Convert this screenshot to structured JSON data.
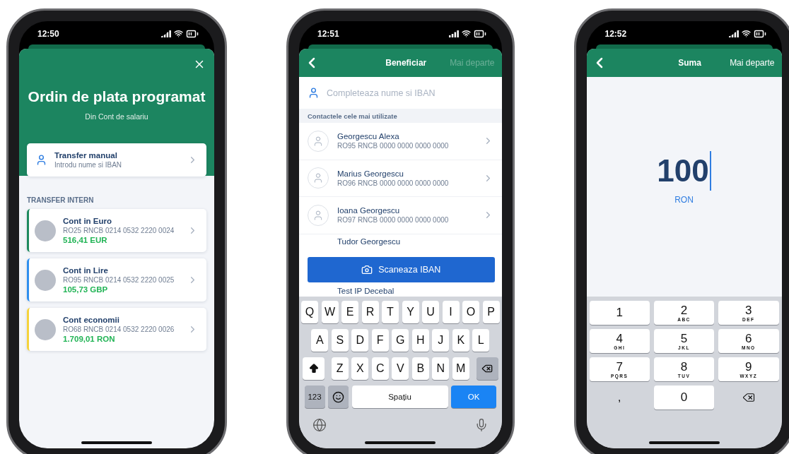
{
  "phones": [
    {
      "kind": "accounts",
      "status_time": "12:50",
      "title": "Ordin de plata programat",
      "subtitle": "Din Cont de salariu",
      "manual_transfer": {
        "title": "Transfer manual",
        "subtitle": "Introdu nume si IBAN"
      },
      "section_label": "TRANSFER INTERN",
      "accounts": [
        {
          "name": "Cont in Euro",
          "iban": "RO25 RNCB 0214 0532 2220 0024",
          "balance": "516,41 EUR",
          "color": "#1e8a5e"
        },
        {
          "name": "Cont in Lire",
          "iban": "RO95 RNCB 0214 0532 2220 0025",
          "balance": "105,73 GBP",
          "color": "#2f8fee"
        },
        {
          "name": "Cont economii",
          "iban": "RO68 RNCB 0214 0532 2220 0026",
          "balance": "1.709,01 RON",
          "color": "#f5d33c"
        }
      ]
    },
    {
      "kind": "beneficiary",
      "status_time": "12:51",
      "header": {
        "title": "Beneficiar",
        "action": "Mai departe",
        "action_disabled": true
      },
      "search": {
        "placeholder": "Completeaza nume si IBAN"
      },
      "section_label": "Contactele cele mai utilizate",
      "contacts": [
        {
          "name": "Georgescu Alexa",
          "iban": "RO95 RNCB 0000 0000 0000 0000"
        },
        {
          "name": "Marius Georgescu",
          "iban": "RO96 RNCB 0000 0000 0000 0000"
        },
        {
          "name": "Ioana Georgescu",
          "iban": "RO97 RNCB 0000 0000 0000 0000"
        },
        {
          "name": "Tudor Georgescu"
        },
        {
          "name": "Test IP Decebal"
        }
      ],
      "scan_button": "Scaneaza IBAN",
      "keyboard": {
        "rows": [
          [
            "Q",
            "W",
            "E",
            "R",
            "T",
            "Y",
            "U",
            "I",
            "O",
            "P"
          ],
          [
            "A",
            "S",
            "D",
            "F",
            "G",
            "H",
            "J",
            "K",
            "L"
          ],
          [
            "Z",
            "X",
            "C",
            "V",
            "B",
            "N",
            "M"
          ]
        ],
        "numbers_key": "123",
        "space_key": "Spațiu",
        "ok_key": "OK"
      }
    },
    {
      "kind": "amount",
      "status_time": "12:52",
      "header": {
        "title": "Suma",
        "action": "Mai departe",
        "action_disabled": false
      },
      "amount": "100",
      "currency": "RON",
      "keypad": [
        {
          "digit": "1"
        },
        {
          "digit": "2",
          "letters": "ABC"
        },
        {
          "digit": "3",
          "letters": "DEF"
        },
        {
          "digit": "4",
          "letters": "GHI"
        },
        {
          "digit": "5",
          "letters": "JKL"
        },
        {
          "digit": "6",
          "letters": "MNO"
        },
        {
          "digit": "7",
          "letters": "PQRS"
        },
        {
          "digit": "8",
          "letters": "TUV"
        },
        {
          "digit": "9",
          "letters": "WXYZ"
        }
      ],
      "comma_key": ",",
      "zero_key": "0"
    }
  ]
}
